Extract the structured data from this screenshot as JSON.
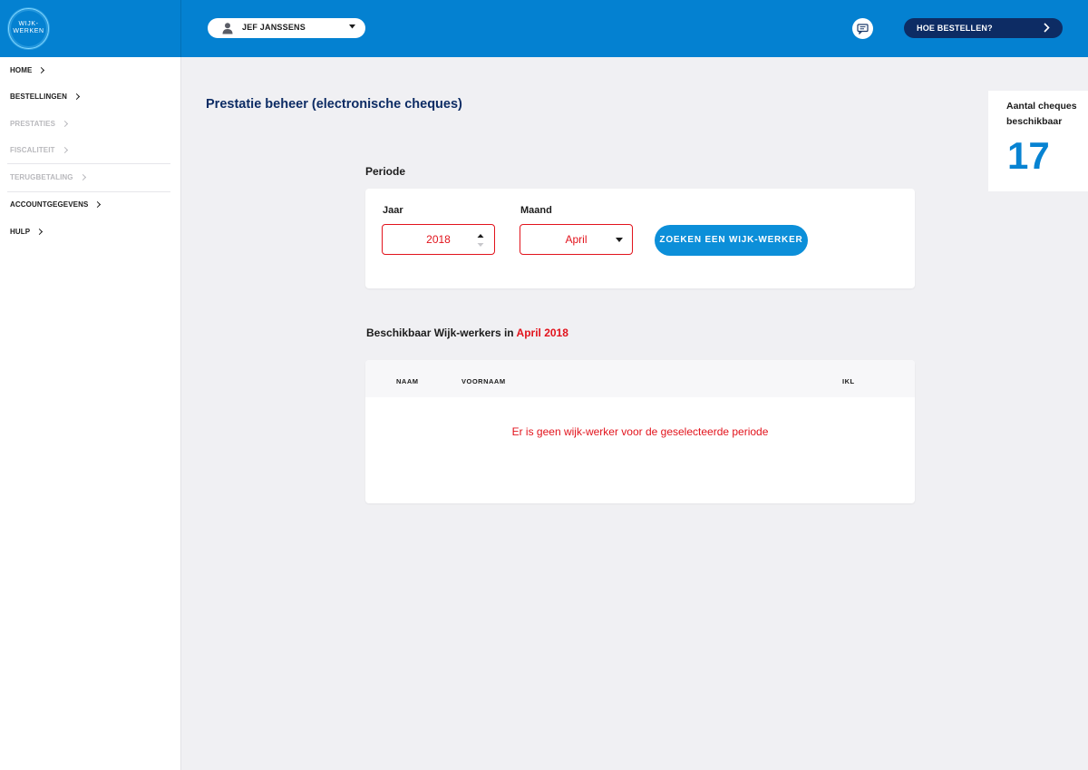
{
  "logo": {
    "line1": "WIJK-",
    "line2": "WERKEN"
  },
  "header": {
    "user_name": "JEF JANSSENS",
    "order_button": "HOE BESTELLEN?"
  },
  "sidebar": {
    "items": [
      {
        "label": "HOME",
        "state": "active"
      },
      {
        "label": "BESTELLINGEN",
        "state": "active"
      },
      {
        "label": "PRESTATIES",
        "state": "disabled"
      },
      {
        "label": "FISCALITEIT",
        "state": "disabled"
      },
      {
        "label": "TERUGBETALING",
        "state": "disabled"
      },
      {
        "label": "ACCOUNTGEGEVENS",
        "state": "active"
      },
      {
        "label": "HULP",
        "state": "active"
      }
    ]
  },
  "page": {
    "title": "Prestatie beheer (electronische cheques)"
  },
  "cheques": {
    "label": "Aantal cheques beschikbaar",
    "count": "17"
  },
  "periode": {
    "title": "Periode",
    "year_label": "Jaar",
    "year_value": "2018",
    "month_label": "Maand",
    "month_value": "April",
    "search_button": "ZOEKEN EEN WIJK-WERKER"
  },
  "available": {
    "title_prefix": "Beschikbaar Wijk-werkers in",
    "title_highlight": "April 2018",
    "columns": [
      "NAAM",
      "VOORNAAM",
      "IKL"
    ],
    "empty_message": "Er is geen wijk-werker voor de geselecteerde periode"
  },
  "colors": {
    "brand_blue": "#0481d1",
    "navy": "#0d2c64",
    "error_red": "#e2131c"
  }
}
